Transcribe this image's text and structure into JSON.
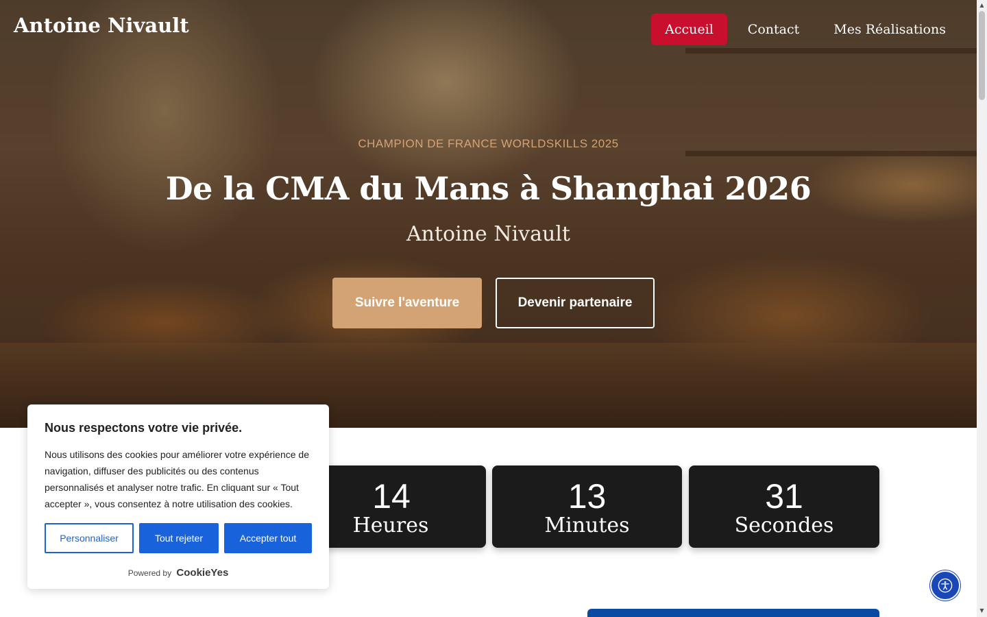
{
  "header": {
    "brand": "Antoine Nivault",
    "nav": [
      {
        "label": "Accueil",
        "active": true
      },
      {
        "label": "Contact",
        "active": false
      },
      {
        "label": "Mes Réalisations",
        "active": false
      }
    ]
  },
  "hero": {
    "kicker": "CHAMPION DE FRANCE WORLDSKILLS 2025",
    "title": "De la CMA du Mans à Shanghai 2026",
    "subtitle": "Antoine Nivault",
    "primary_button": "Suivre l'aventure",
    "secondary_button": "Devenir partenaire"
  },
  "countdown": [
    {
      "value": "14",
      "label": "Heures"
    },
    {
      "value": "13",
      "label": "Minutes"
    },
    {
      "value": "31",
      "label": "Secondes"
    }
  ],
  "cookie_banner": {
    "title": "Nous respectons votre vie privée.",
    "text": "Nous utilisons des cookies pour améliorer votre expérience de navigation, diffuser des publicités ou des contenus personnalisés et analyser notre trafic. En cliquant sur « Tout accepter », vous consentez à notre utilisation des cookies.",
    "customize": "Personnaliser",
    "reject": "Tout rejeter",
    "accept": "Accepter tout",
    "powered_by": "Powered by",
    "provider": "CookieYes"
  },
  "icons": {
    "accessibility": "accessibility-icon"
  },
  "colors": {
    "accent_red": "#c8102e",
    "gold": "#d4a373",
    "cookie_blue": "#1863dc",
    "countdown_bg": "#1b1b1b",
    "a11y_blue": "#1947b8"
  }
}
